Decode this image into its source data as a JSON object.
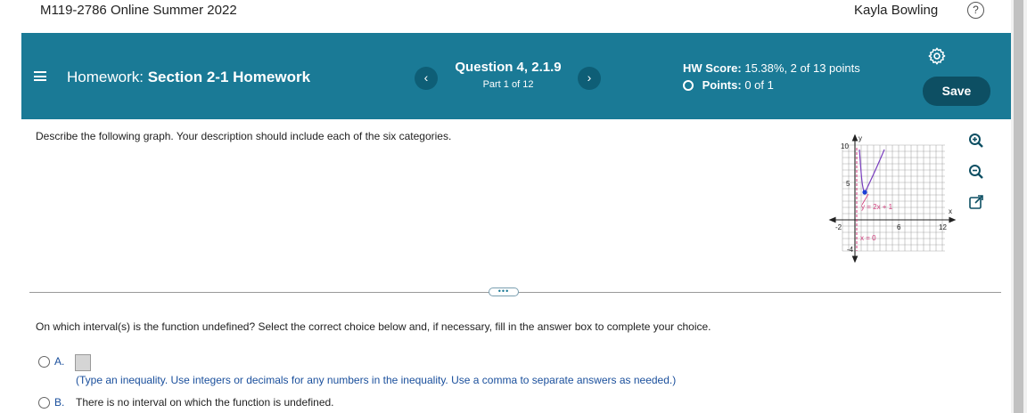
{
  "header": {
    "course_title": "M119-2786 Online Summer 2022",
    "user_name": "Kayla Bowling",
    "help_glyph": "?"
  },
  "banner": {
    "hw_prefix": "Homework:",
    "hw_name": "Section 2-1 Homework",
    "question_title": "Question 4, 2.1.9",
    "question_part": "Part 1 of 12",
    "prev_glyph": "‹",
    "next_glyph": "›",
    "hw_score_label": "HW Score:",
    "hw_score_value": "15.38%, 2 of 13 points",
    "points_label": "Points:",
    "points_value": "0 of 1",
    "save_label": "Save",
    "background_color": "#1a7a96"
  },
  "prompt": "Describe the following graph. Your description should include each of the six categories.",
  "graph": {
    "y_axis_label": "y",
    "x_axis_label": "x",
    "tick_y_top": "10",
    "tick_y_mid": "5",
    "tick_x_left": "-2",
    "tick_x_mid": "6",
    "tick_x_right": "12",
    "tick_y_bottom": "-4",
    "curve_label": "y = 2x + 1",
    "asymptote_label": "x = 0"
  },
  "tools": [
    "zoom-in-icon",
    "zoom-out-icon",
    "popout-icon"
  ],
  "more_glyph": "•••",
  "question": "On which interval(s) is the function undefined? Select the correct choice below and, if necessary, fill in the answer box to complete your choice.",
  "options": {
    "a_letter": "A.",
    "a_hint": "(Type an inequality. Use integers or decimals for any numbers in the inequality. Use a comma to separate answers as needed.)",
    "b_letter": "B.",
    "b_text": "There is no interval on which the function is undefined."
  }
}
